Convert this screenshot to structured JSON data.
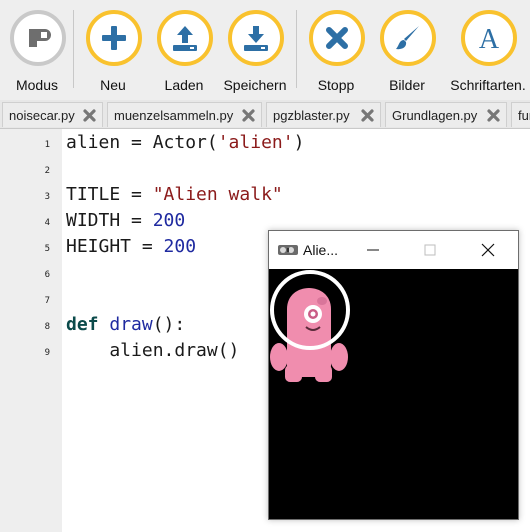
{
  "toolbar": {
    "buttons": [
      {
        "label": "Modus",
        "icon": "mode-icon"
      },
      {
        "label": "Neu",
        "icon": "plus-icon"
      },
      {
        "label": "Laden",
        "icon": "upload-icon"
      },
      {
        "label": "Speichern",
        "icon": "download-icon"
      },
      {
        "label": "Stopp",
        "icon": "x-icon"
      },
      {
        "label": "Bilder",
        "icon": "brush-icon"
      },
      {
        "label": "Schriftarten.",
        "icon": "font-icon"
      }
    ],
    "accent": "#f9c22e",
    "icon_color": "#2d6fa5"
  },
  "tabs": [
    {
      "label": "noisecar.py"
    },
    {
      "label": "muenzelsammeln.py"
    },
    {
      "label": "pgzblaster.py"
    },
    {
      "label": "Grundlagen.py"
    },
    {
      "label": "fun"
    }
  ],
  "editor": {
    "line_numbers": [
      "1",
      "2",
      "3",
      "4",
      "5",
      "6",
      "7",
      "8",
      "9"
    ]
  },
  "game_window": {
    "title": "Alie..."
  }
}
